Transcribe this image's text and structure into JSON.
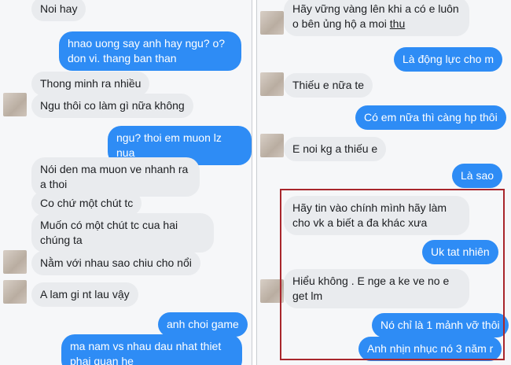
{
  "left_chat": {
    "messages": [
      {
        "side": "in",
        "text": "Noi hay"
      },
      {
        "side": "out",
        "text": "hnao uong say anh hay ngu? o? don vi. thang ban than"
      },
      {
        "side": "in",
        "text": "Thong minh ra nhiều"
      },
      {
        "side": "in",
        "text": "Ngu thôi co làm gì nữa không"
      },
      {
        "side": "out",
        "text": "ngu? thoi em muon lz nua"
      },
      {
        "side": "in",
        "text": "Nói den ma muon ve nhanh ra a thoi"
      },
      {
        "side": "in",
        "text": "Co chứ một chút tc"
      },
      {
        "side": "in",
        "text": "Muốn có một chút tc cua hai chúng ta"
      },
      {
        "side": "in",
        "text": "Nằm với nhau sao chiu cho nổi"
      },
      {
        "side": "in",
        "text": "A lam gi nt lau vậy"
      },
      {
        "side": "out",
        "text": "anh choi game"
      },
      {
        "side": "out",
        "text": "ma nam vs nhau dau nhat thiet phai quan he"
      }
    ]
  },
  "right_chat": {
    "messages": [
      {
        "side": "in",
        "text_main": "Hãy vững vàng lên khi a có e luôn o bên ủng hộ a moi ",
        "text_underlined": "thu"
      },
      {
        "side": "out",
        "text": "Là động lực cho m"
      },
      {
        "side": "in",
        "text": "Thiếu e nữa te"
      },
      {
        "side": "out",
        "text": "Có em nữa thì càng hp thôi"
      },
      {
        "side": "in",
        "text": "E noi kg a thiếu e"
      },
      {
        "side": "out",
        "text": "Là sao"
      },
      {
        "side": "in",
        "text": "Hãy tin vào chính mình hãy làm cho vk a biết a đa khác xưa"
      },
      {
        "side": "out",
        "text": "Uk tat nhiên"
      },
      {
        "side": "in",
        "text": "Hiểu không . E nge a ke ve no e get lm"
      },
      {
        "side": "out",
        "text": "Nó chỉ là 1 mảnh vỡ thôi"
      },
      {
        "side": "out",
        "text": "Anh nhịn nhục nó 3 năm r"
      }
    ]
  },
  "colors": {
    "incoming_bubble": "#e9ebee",
    "outgoing_bubble": "#2e8cf5",
    "highlight_border": "#a8262c"
  }
}
